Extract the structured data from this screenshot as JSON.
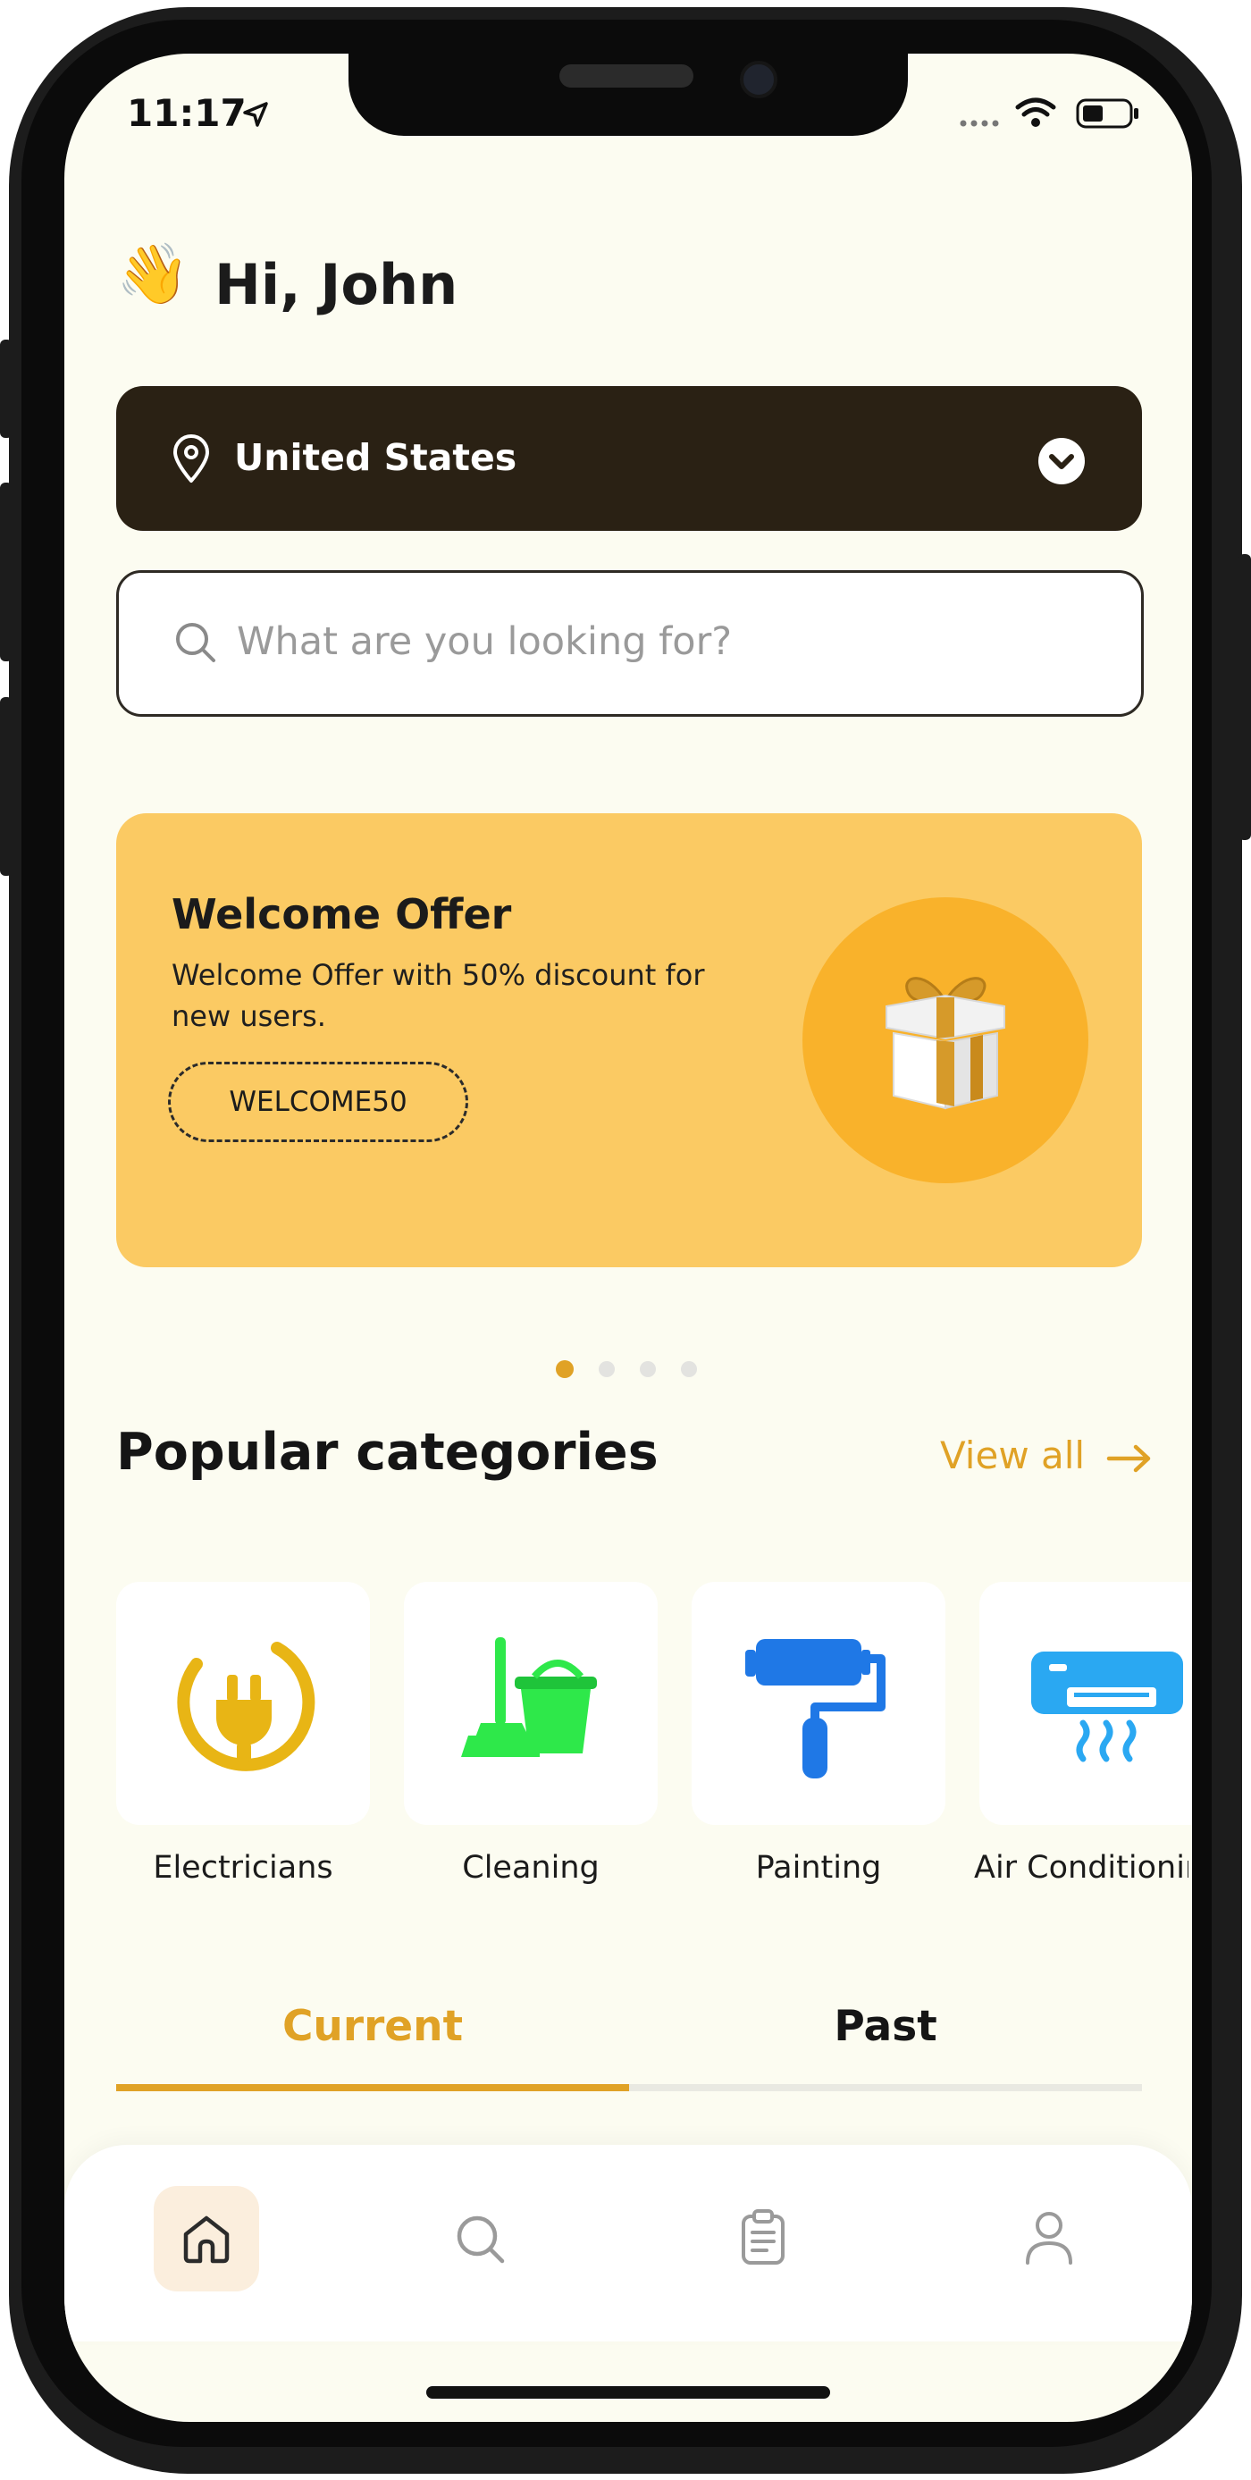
{
  "status_bar": {
    "time": "11:17"
  },
  "greeting": {
    "emoji": "👋",
    "text": "Hi, John"
  },
  "location": {
    "label": "United States"
  },
  "search": {
    "placeholder": "What are you looking for?"
  },
  "offer": {
    "title": "Welcome Offer",
    "description": "Welcome Offer with 50% discount for new users.",
    "code": "WELCOME50"
  },
  "carousel": {
    "total": 4,
    "active": 1
  },
  "categories": {
    "title": "Popular categories",
    "view_all": "View all",
    "items": [
      {
        "label": "Electricians",
        "icon": "plug-icon"
      },
      {
        "label": "Cleaning",
        "icon": "mop-bucket-icon"
      },
      {
        "label": "Painting",
        "icon": "paint-roller-icon"
      },
      {
        "label": "Air Conditioning",
        "icon": "air-conditioner-icon"
      }
    ]
  },
  "tabs": {
    "items": [
      "Current",
      "Past"
    ],
    "active": "Current"
  },
  "bottom_nav": {
    "items": [
      "home-icon",
      "search-icon",
      "orders-icon",
      "profile-icon"
    ],
    "active": "home-icon"
  },
  "colors": {
    "accent": "#e0a226",
    "dark_bar": "#2a2114",
    "offer_bg": "#fbca63",
    "screen_bg": "#fcfcf1",
    "electricians_icon": "#e8b515",
    "cleaning_icon": "#2ee84a",
    "painting_icon": "#1f78e6",
    "ac_icon": "#2aa8f2"
  }
}
